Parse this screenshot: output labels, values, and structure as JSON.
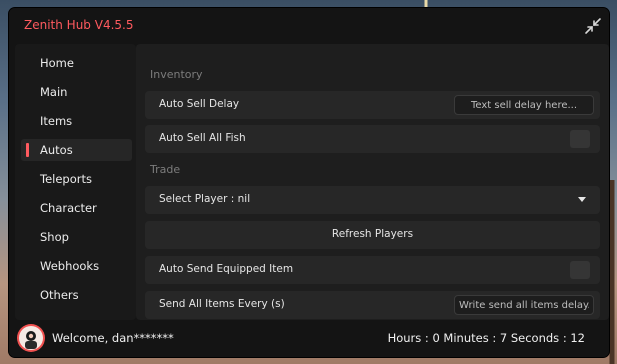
{
  "window": {
    "title": "Zenith Hub V4.5.5"
  },
  "sidebar": {
    "items": [
      {
        "label": "Home"
      },
      {
        "label": "Main"
      },
      {
        "label": "Items"
      },
      {
        "label": "Autos",
        "active": true
      },
      {
        "label": "Teleports"
      },
      {
        "label": "Character"
      },
      {
        "label": "Shop"
      },
      {
        "label": "Webhooks"
      },
      {
        "label": "Others"
      }
    ]
  },
  "content": {
    "inventory_section": "Inventory",
    "auto_sell_delay": {
      "label": "Auto Sell Delay",
      "placeholder": "Text sell delay here...",
      "value": ""
    },
    "auto_sell_all_fish": {
      "label": "Auto Sell All Fish",
      "enabled": false
    },
    "trade_section": "Trade",
    "select_player": {
      "label": "Select Player : nil"
    },
    "refresh_players": {
      "label": "Refresh Players"
    },
    "auto_send_equipped": {
      "label": "Auto Send Equipped Item",
      "enabled": false
    },
    "send_all_items": {
      "label": "Send All Items Every (s)",
      "placeholder": "Write send all items delay.",
      "value": ""
    }
  },
  "footer": {
    "welcome": "Welcome, dan*******",
    "timer": "Hours : 0 Minutes : 7 Seconds : 12"
  },
  "colors": {
    "accent": "#ff5a5f",
    "window_bg": "#141414",
    "panel_bg": "#1e1e1e",
    "row_bg": "#272727"
  },
  "icons": {
    "minimize": "collapse-arrows-icon",
    "avatar": "user-avatar-icon",
    "dropdown": "chevron-down-icon"
  }
}
